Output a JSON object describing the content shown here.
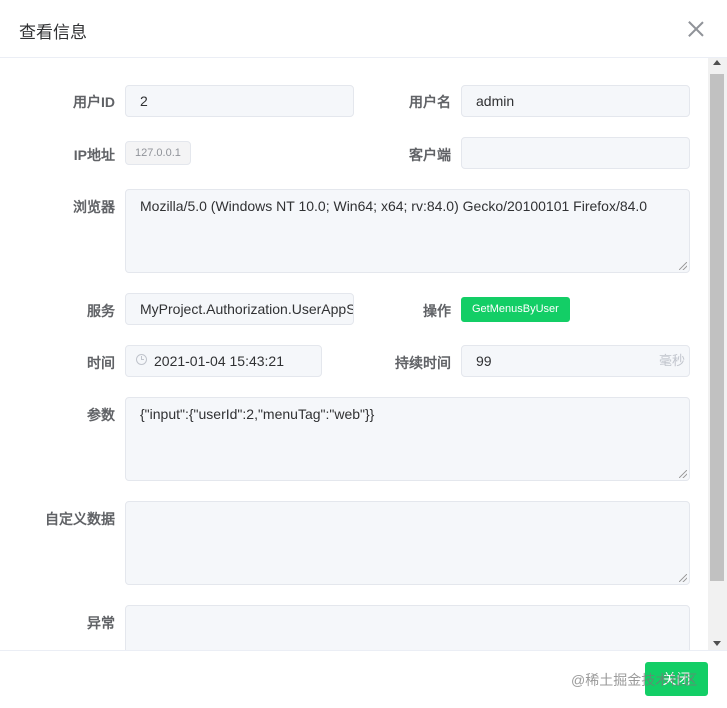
{
  "dialog": {
    "title": "查看信息"
  },
  "fields": {
    "user_id": {
      "label": "用户ID",
      "value": "2"
    },
    "username": {
      "label": "用户名",
      "value": "admin"
    },
    "ip": {
      "label": "IP地址",
      "value": "127.0.0.1"
    },
    "client": {
      "label": "客户端",
      "value": ""
    },
    "browser": {
      "label": "浏览器",
      "value": "Mozilla/5.0 (Windows NT 10.0; Win64; x64; rv:84.0) Gecko/20100101 Firefox/84.0"
    },
    "service": {
      "label": "服务",
      "value": "MyProject.Authorization.UserAppS"
    },
    "operation": {
      "label": "操作",
      "value": "GetMenusByUser"
    },
    "time": {
      "label": "时间",
      "value": "2021-01-04 15:43:21"
    },
    "duration": {
      "label": "持续时间",
      "value": "99",
      "unit": "毫秒"
    },
    "params": {
      "label": "参数",
      "value": "{\"input\":{\"userId\":2,\"menuTag\":\"web\"}}"
    },
    "custom_data": {
      "label": "自定义数据",
      "value": ""
    },
    "exception": {
      "label": "异常",
      "value": ""
    }
  },
  "footer": {
    "close_label": "关闭",
    "watermark": "@稀土掘金技术社区"
  },
  "colors": {
    "accent": "#13ce66",
    "input_bg": "#f5f7fa",
    "border": "#e4e7ed"
  }
}
